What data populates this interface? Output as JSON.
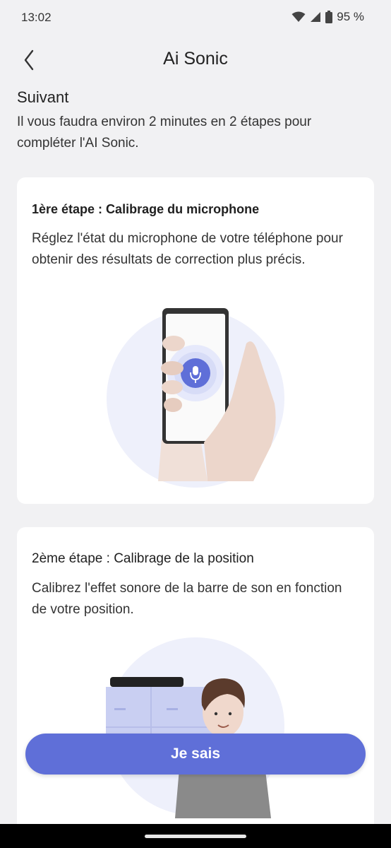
{
  "status": {
    "time": "13:02",
    "battery": "95 %"
  },
  "appbar": {
    "title": "Ai Sonic"
  },
  "intro": {
    "heading": "Suivant",
    "text": "Il vous faudra environ 2 minutes en 2 étapes pour compléter l'AI Sonic."
  },
  "steps": [
    {
      "title": "1ère étape : Calibrage du microphone",
      "description": "Réglez l'état du microphone de votre téléphone pour obtenir des résultats de correction plus précis."
    },
    {
      "title": "2ème étape : Calibrage de la position",
      "description": "Calibrez l'effet sonore de la barre de son en fonction de votre position."
    }
  ],
  "cta": {
    "label": "Je sais"
  },
  "colors": {
    "accent": "#5f6fd8",
    "background": "#f1f1f3",
    "card": "#ffffff"
  },
  "icons": [
    "wifi-icon",
    "cellular-signal-icon",
    "battery-icon",
    "back-arrow-icon",
    "microphone-icon"
  ]
}
